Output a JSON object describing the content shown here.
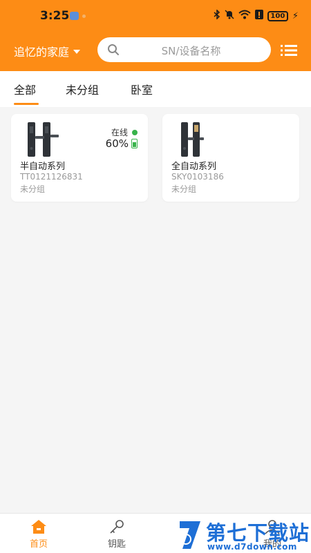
{
  "status_bar": {
    "time": "3:25",
    "battery": "100"
  },
  "header": {
    "home_name": "追忆的家庭",
    "search_placeholder": "SN/设备名称"
  },
  "tabs": [
    {
      "label": "全部",
      "active": true
    },
    {
      "label": "未分组",
      "active": false
    },
    {
      "label": "卧室",
      "active": false
    }
  ],
  "devices": [
    {
      "name": "半自动系列",
      "sn": "TT0121126831",
      "group": "未分组",
      "status": "在线",
      "battery": "60%"
    },
    {
      "name": "全自动系列",
      "sn": "SKY0103186",
      "group": "未分组"
    }
  ],
  "bottom_nav": [
    {
      "label": "首页",
      "icon": "home-icon",
      "active": true
    },
    {
      "label": "钥匙",
      "icon": "key-icon",
      "active": false
    },
    {
      "label": "我的",
      "icon": "user-icon",
      "active": false
    }
  ],
  "watermark": {
    "title": "第七下载站",
    "url": "www.d7down.com"
  },
  "colors": {
    "brand_orange": "#fd8c15",
    "online_green": "#37b34a",
    "watermark_blue": "#1e6fd6"
  }
}
